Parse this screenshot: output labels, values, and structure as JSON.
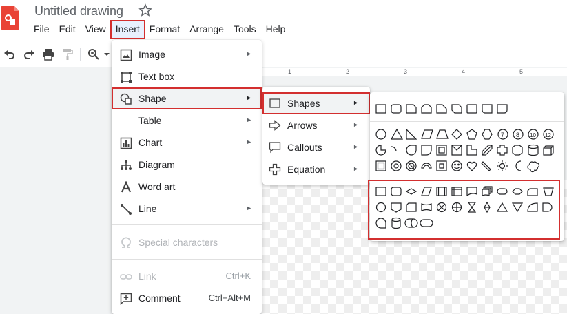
{
  "header": {
    "doc_title": "Untitled drawing",
    "icons": [
      "drawings-app-icon",
      "star-icon"
    ]
  },
  "menubar": {
    "items": [
      {
        "label": "File"
      },
      {
        "label": "Edit"
      },
      {
        "label": "View"
      },
      {
        "label": "Insert",
        "active": true
      },
      {
        "label": "Format"
      },
      {
        "label": "Arrange"
      },
      {
        "label": "Tools"
      },
      {
        "label": "Help"
      }
    ]
  },
  "toolbar": {
    "icons": [
      "undo-icon",
      "redo-icon",
      "print-icon",
      "paint-format-icon",
      "zoom-icon",
      "chevron-down-icon"
    ]
  },
  "ruler": {
    "ticks": [
      "1",
      "2",
      "3",
      "4",
      "5"
    ]
  },
  "insert_menu": {
    "items": [
      {
        "label": "Image",
        "icon": "image-icon",
        "submenu": true
      },
      {
        "label": "Text box",
        "icon": "text-box-icon"
      },
      {
        "label": "Shape",
        "icon": "shape-icon",
        "submenu": true,
        "selected": true
      },
      {
        "label": "Table",
        "icon": "",
        "submenu": true
      },
      {
        "label": "Chart",
        "icon": "chart-icon",
        "submenu": true
      },
      {
        "label": "Diagram",
        "icon": "diagram-icon"
      },
      {
        "label": "Word art",
        "icon": "word-art-icon"
      },
      {
        "label": "Line",
        "icon": "line-icon",
        "submenu": true
      },
      {
        "label": "Special characters",
        "icon": "omega-icon",
        "disabled": true
      },
      {
        "label": "Link",
        "icon": "link-icon",
        "shortcut": "Ctrl+K",
        "disabled": true
      },
      {
        "label": "Comment",
        "icon": "comment-add-icon",
        "shortcut": "Ctrl+Alt+M"
      }
    ]
  },
  "shape_submenu": {
    "items": [
      {
        "label": "Shapes",
        "icon": "square-icon",
        "selected": true
      },
      {
        "label": "Arrows",
        "icon": "arrow-right-icon"
      },
      {
        "label": "Callouts",
        "icon": "callout-icon"
      },
      {
        "label": "Equation",
        "icon": "plus-icon"
      }
    ]
  },
  "shapes_palette": {
    "groups": [
      "basic-rectangles",
      "basic-shapes",
      "flowchart-shapes"
    ]
  },
  "colors": {
    "highlight_red": "#d32f2f",
    "app_red": "#e94235"
  }
}
